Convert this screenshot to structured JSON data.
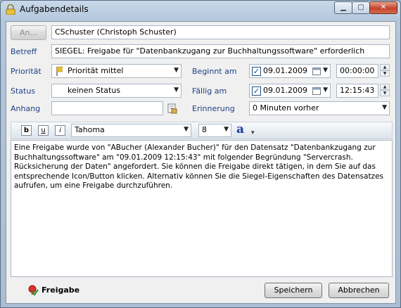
{
  "window": {
    "title": "Aufgabendetails",
    "min_glyph": "▁",
    "max_glyph": "▢",
    "close_glyph": "✕"
  },
  "form": {
    "an_button": "An...",
    "an_value": "CSchuster (Christoph Schuster)",
    "betreff_label": "Betreff",
    "betreff_value": "SIEGEL: Freigabe für \"Datenbankzugang zur Buchhaltungssoftware\" erforderlich",
    "prioritaet_label": "Priorität",
    "prioritaet_value": "Priorität mittel",
    "status_label": "Status",
    "status_value": "keinen Status",
    "anhang_label": "Anhang",
    "anhang_value": "",
    "beginnt_label": "Beginnt am",
    "beginnt_date": "09.01.2009",
    "beginnt_time": "00:00:00",
    "faellig_label": "Fällig am",
    "faellig_date": "09.01.2009",
    "faellig_time": "12:15:43",
    "erinnerung_label": "Erinnerung",
    "erinnerung_value": "0 Minuten vorher"
  },
  "toolbar": {
    "bold": "b",
    "underline": "u",
    "italic": "i",
    "font": "Tahoma",
    "size": "8",
    "color_glyph": "a",
    "overflow_glyph": "▾"
  },
  "body_text": "Eine Freigabe wurde von \"ABucher (Alexander Bucher)\" für den Datensatz \"Datenbankzugang zur Buchhaltungssoftware\" am \"09.01.2009 12:15:43\" mit folgender Begründung \"Servercrash. Rücksicherung der Daten\" angefordert. Sie können die Freigabe direkt tätigen, in dem Sie auf das entsprechende Icon/Button klicken. Alternativ können Sie die Siegel-Eigenschaften des Datensatzes aufrufen, um eine Freigabe durchzuführen.",
  "footer": {
    "freigabe_label": "Freigabe",
    "save_label": "Speichern",
    "cancel_label": "Abbrechen"
  },
  "colors": {
    "label_blue": "#1e3f86",
    "flag_yellow": "#e8c020",
    "close_red": "#c3442a"
  },
  "icons": [
    "lock-icon",
    "flag-icon",
    "calendar-icon",
    "attachment-icon",
    "text-color-icon",
    "approve-icon"
  ]
}
